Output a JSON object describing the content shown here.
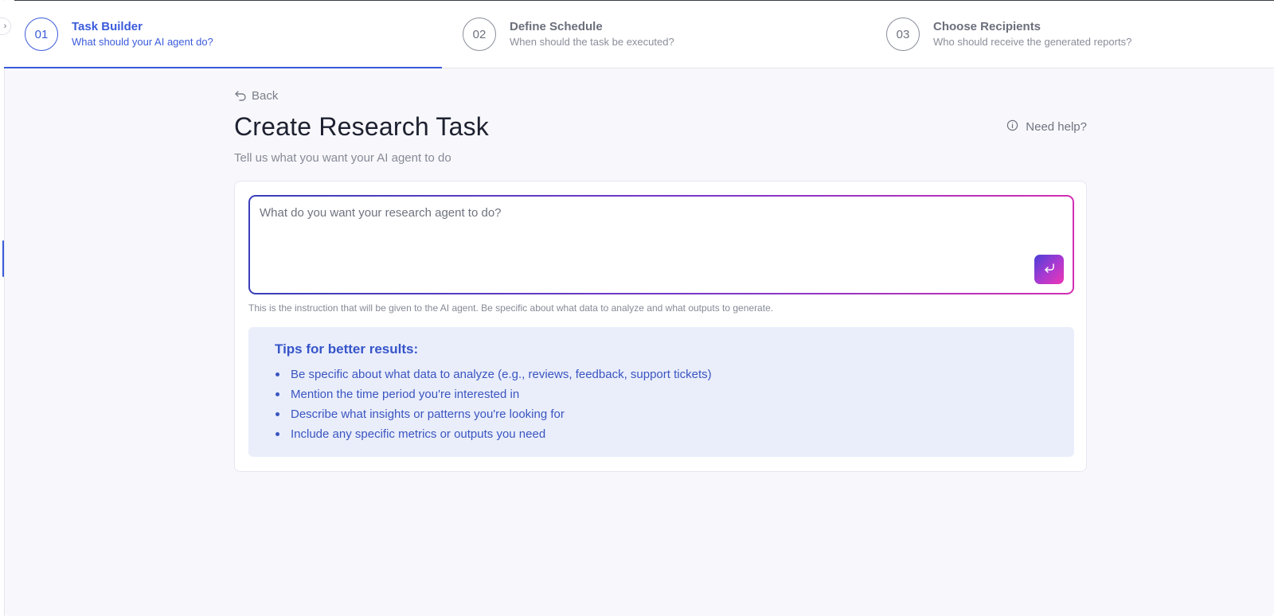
{
  "stepper": {
    "steps": [
      {
        "number": "01",
        "title": "Task Builder",
        "subtitle": "What should your AI agent do?"
      },
      {
        "number": "02",
        "title": "Define Schedule",
        "subtitle": "When should the task be executed?"
      },
      {
        "number": "03",
        "title": "Choose Recipients",
        "subtitle": "Who should receive the generated reports?"
      }
    ],
    "active_index": 0
  },
  "header": {
    "back_label": "Back",
    "title": "Create Research Task",
    "subtitle": "Tell us what you want your AI agent to do",
    "help_label": "Need help?"
  },
  "task_input": {
    "value": "",
    "placeholder": "What do you want your research agent to do?",
    "hint": "This is the instruction that will be given to the AI agent. Be specific about what data to analyze and what outputs to generate."
  },
  "tips": {
    "title": "Tips for better results:",
    "items": [
      "Be specific about what data to analyze (e.g., reviews, feedback, support tickets)",
      "Mention the time period you're interested in",
      "Describe what insights or patterns you're looking for",
      "Include any specific metrics or outputs you need"
    ]
  },
  "icons": {
    "back": "undo-arrow-icon",
    "help": "info-circle-icon",
    "submit": "enter-return-icon",
    "sidebar_toggle": "chevron-right-icon"
  },
  "colors": {
    "accent": "#3b5bdb",
    "gradient_start": "#3a3fb8",
    "gradient_end": "#d22fb4",
    "tips_bg": "#eaeefb",
    "page_bg": "#f8f8fc"
  }
}
